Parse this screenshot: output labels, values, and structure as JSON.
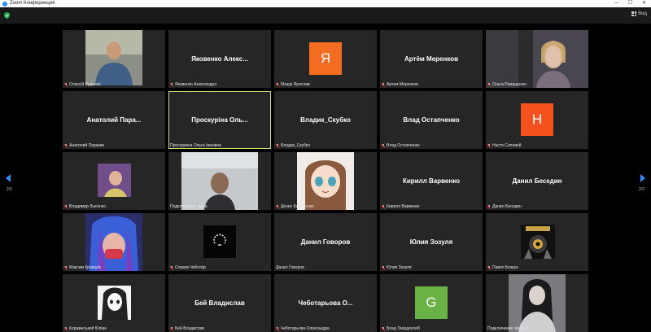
{
  "window": {
    "title": "Zoom Конференция",
    "minimize": "—",
    "maximize": "☐",
    "close": "✕"
  },
  "toolbar": {
    "view_label": "Вид"
  },
  "pager": {
    "left": "2/2",
    "right": "2/2"
  },
  "colors": {
    "accent": "#2d8cff",
    "active_border": "#c6e26a",
    "tile_bg": "#262626",
    "mute": "#e02828"
  },
  "participants": [
    {
      "label": "Олексій Руденко",
      "type": "video",
      "big": ""
    },
    {
      "label": "Яковенко Александра",
      "type": "name",
      "big": "Яковенко Алекс..."
    },
    {
      "label": "Мазур Ярослав",
      "type": "avatar",
      "big": "Я",
      "color": "#f26d21"
    },
    {
      "label": "Артем Меренков",
      "type": "name",
      "big": "Артём Меренков"
    },
    {
      "label": "Ольга Ромащенко",
      "type": "video",
      "big": ""
    },
    {
      "label": "Анатолий Паракин",
      "type": "name",
      "big": "Анатолий Пара..."
    },
    {
      "label": "Проскурина Ольга Іванівна",
      "type": "name",
      "big": "Проскуріна Оль...",
      "active": true
    },
    {
      "label": "Владик_Скубко",
      "type": "name",
      "big": "Владик_Скубко"
    },
    {
      "label": "Влад Остапченко",
      "type": "name",
      "big": "Влад Остапченко"
    },
    {
      "label": "Настя Соловей",
      "type": "avatar",
      "big": "H",
      "color": "#f4511e"
    },
    {
      "label": "Владимир Лысенко",
      "type": "video",
      "big": ""
    },
    {
      "label": "Подключение звука",
      "type": "video",
      "big": ""
    },
    {
      "label": "Денис Балабенко",
      "type": "video",
      "big": ""
    },
    {
      "label": "Кирилл Варвенко",
      "type": "name",
      "big": "Кирилл Варвенко"
    },
    {
      "label": "Данил Беседин",
      "type": "name",
      "big": "Данил Беседин"
    },
    {
      "label": "Максим Кравцов",
      "type": "video",
      "big": ""
    },
    {
      "label": "Славик Чебота́р",
      "type": "video",
      "big": ""
    },
    {
      "label": "Данил Говоров",
      "type": "name",
      "big": "Данил Говоров"
    },
    {
      "label": "Юлия Зозуля",
      "type": "name",
      "big": "Юлия Зозуля"
    },
    {
      "label": "Павел Безрук",
      "type": "video",
      "big": ""
    },
    {
      "label": "Коржинський Юліан",
      "type": "video",
      "big": ""
    },
    {
      "label": "Бей Владислав",
      "type": "name",
      "big": "Бей Владислав"
    },
    {
      "label": "Чеботарьова Олександра",
      "type": "name",
      "big": "Чеботарьова О..."
    },
    {
      "label": "Влад Твердохлеб",
      "type": "avatar",
      "big": "G",
      "color": "#6ab245"
    },
    {
      "label": "Подключение звука ™",
      "type": "video",
      "big": ""
    }
  ]
}
